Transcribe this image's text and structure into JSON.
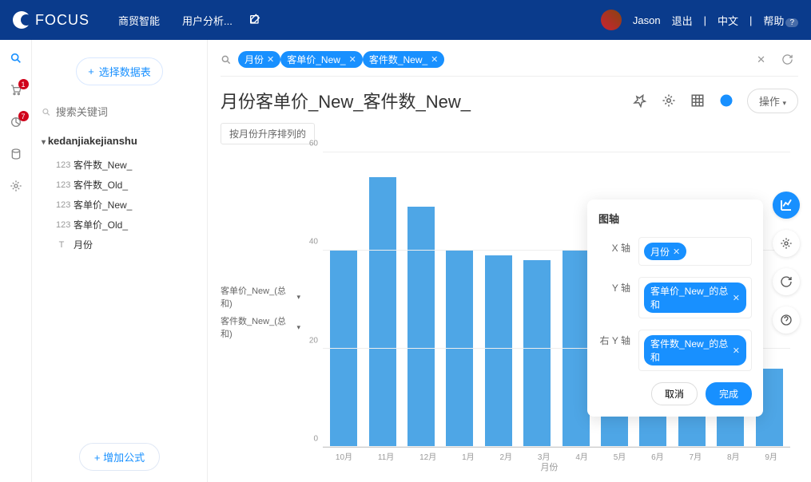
{
  "header": {
    "logo": "FOCUS",
    "nav": [
      "商贸智能",
      "用户分析..."
    ],
    "user": "Jason",
    "logout": "退出",
    "lang": "中文",
    "help": "帮助"
  },
  "rail_badges": {
    "r1": "1",
    "r2": "7"
  },
  "sidebar": {
    "select_btn": "选择数据表",
    "search_placeholder": "搜索关键词",
    "table_name": "kedanjiakejianshu",
    "fields": [
      {
        "icon": "123",
        "label": "客件数_New_"
      },
      {
        "icon": "123",
        "label": "客件数_Old_"
      },
      {
        "icon": "123",
        "label": "客单价_New_"
      },
      {
        "icon": "123",
        "label": "客单价_Old_"
      },
      {
        "icon": "T",
        "label": "月份"
      }
    ],
    "add_formula": "+ 增加公式"
  },
  "query": {
    "pills": [
      "月份",
      "客单价_New_",
      "客件数_New_"
    ]
  },
  "title": "月份客单价_New_客件数_New_",
  "operate": "操作",
  "sort_chip": "按月份升序排列的",
  "legend": [
    "客单价_New_(总和)",
    "客件数_New_(总和)"
  ],
  "right_series": [
    "总和",
    "总和"
  ],
  "panel": {
    "title": "图轴",
    "x_label": "X 轴",
    "y_label": "Y 轴",
    "ry_label": "右 Y 轴",
    "x_pill": "月份",
    "y_pill": "客单价_New_的总和",
    "ry_pill": "客件数_New_的总和",
    "cancel": "取消",
    "done": "完成"
  },
  "chart_data": {
    "type": "bar",
    "title": "月份客单价_New_客件数_New_",
    "xlabel": "月份",
    "ylabel": "",
    "ylim": [
      0,
      60
    ],
    "yticks": [
      0,
      20,
      40,
      60
    ],
    "categories": [
      "10月",
      "11月",
      "12月",
      "1月",
      "2月",
      "3月",
      "4月",
      "5月",
      "6月",
      "7月",
      "8月",
      "9月"
    ],
    "series": [
      {
        "name": "客单价_New_(总和)",
        "values": [
          40,
          55,
          49,
          40,
          39,
          38,
          40,
          37,
          16,
          16,
          16,
          16
        ]
      },
      {
        "name": "客件数_New_(总和)",
        "values": [
          1.5,
          1.5,
          1.5,
          1.5,
          1.5,
          1.5,
          1.5,
          1.5,
          1.5,
          1.5,
          1.5,
          1.5
        ]
      }
    ]
  }
}
